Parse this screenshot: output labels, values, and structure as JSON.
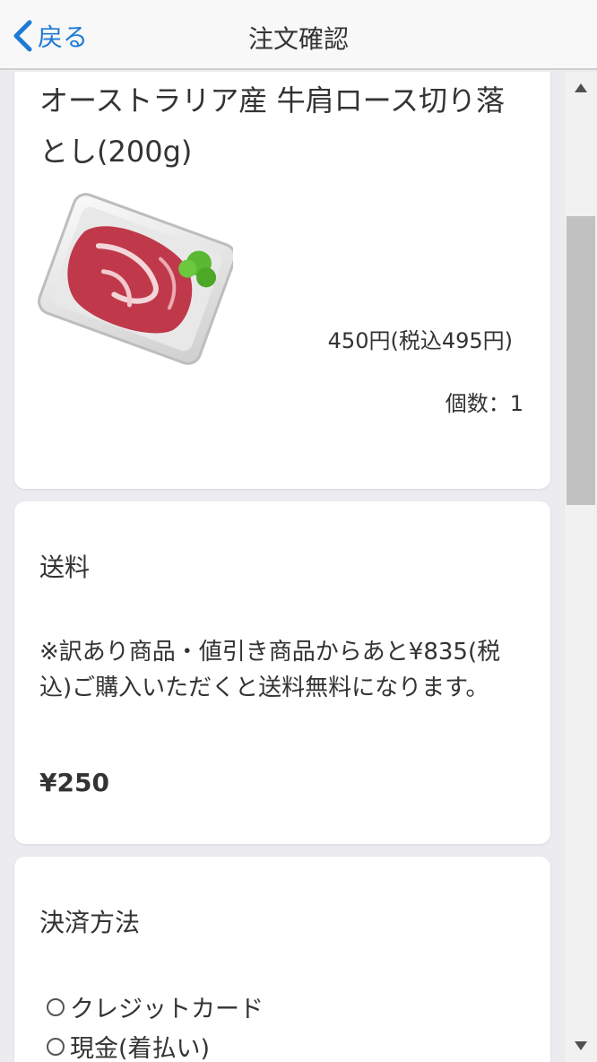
{
  "header": {
    "back_label": "戻る",
    "title": "注文確認"
  },
  "product": {
    "name": "オーストラリア産 牛肩ロース切り落とし(200g)",
    "price": "450円(税込495円)",
    "quantity": "個数：1",
    "image_icon": "meat-tray-icon"
  },
  "shipping": {
    "title": "送料",
    "note": "※訳あり商品・値引き商品からあと¥835(税込)ご購入いただくと送料無料になります。",
    "amount": "¥250"
  },
  "payment": {
    "title": "決済方法",
    "options": [
      "クレジットカード",
      "現金(着払い)"
    ]
  },
  "colors": {
    "accent": "#1e7bd4",
    "background": "#ebebf0",
    "card": "#ffffff"
  }
}
